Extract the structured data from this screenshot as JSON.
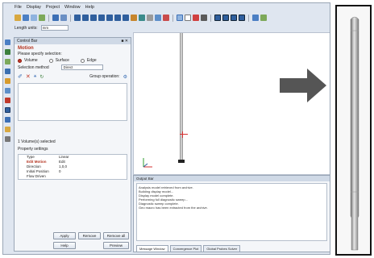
{
  "menu": [
    "File",
    "Display",
    "Project",
    "Window",
    "Help"
  ],
  "toolbar2": {
    "label": "Length units:",
    "value": "mm"
  },
  "panel": {
    "title": "Control Bar",
    "title_icons": "■ ✕",
    "section": "Motion",
    "hint": "Please specify selection:",
    "modes": [
      {
        "label": "Volume",
        "selected": true
      },
      {
        "label": "Surface",
        "selected": false
      },
      {
        "label": "Edge",
        "selected": false
      }
    ],
    "selection_method_label": "Selection method",
    "selection_method_value": "Direct",
    "group_operation_label": "Group operation:",
    "count_text": "1 Volume(s) selected",
    "props_title": "Property settings",
    "properties": [
      {
        "key": "Type",
        "value": "Linear",
        "red": false
      },
      {
        "key": "Edit Motion",
        "value": "Edit",
        "red": true
      },
      {
        "key": "Direction",
        "value": "1,0,0",
        "red": false
      },
      {
        "key": "Initial Position",
        "value": "0",
        "red": false
      },
      {
        "key": "Flow Driven",
        "value": "",
        "red": false
      }
    ],
    "buttons": {
      "apply": "Apply",
      "remove": "Remove",
      "remove_all": "Remove all",
      "help": "Help",
      "preview": "Preview"
    }
  },
  "output": {
    "title": "Output Bar",
    "lines": [
      "Analysis model retrieved from archive.",
      "Building display model...",
      "Display model complete.",
      "Performing full diagnostic sweep...",
      "Diagnostic sweep complete.",
      "Geo macro has been extracted from the archive."
    ],
    "tabs": [
      "Message Window",
      "Convergence Plot",
      "Global Probes Solver"
    ]
  },
  "colors": {
    "accent_red": "#b3321e",
    "panel_bg": "#f4f6f9",
    "frame": "#dfe6f0"
  }
}
